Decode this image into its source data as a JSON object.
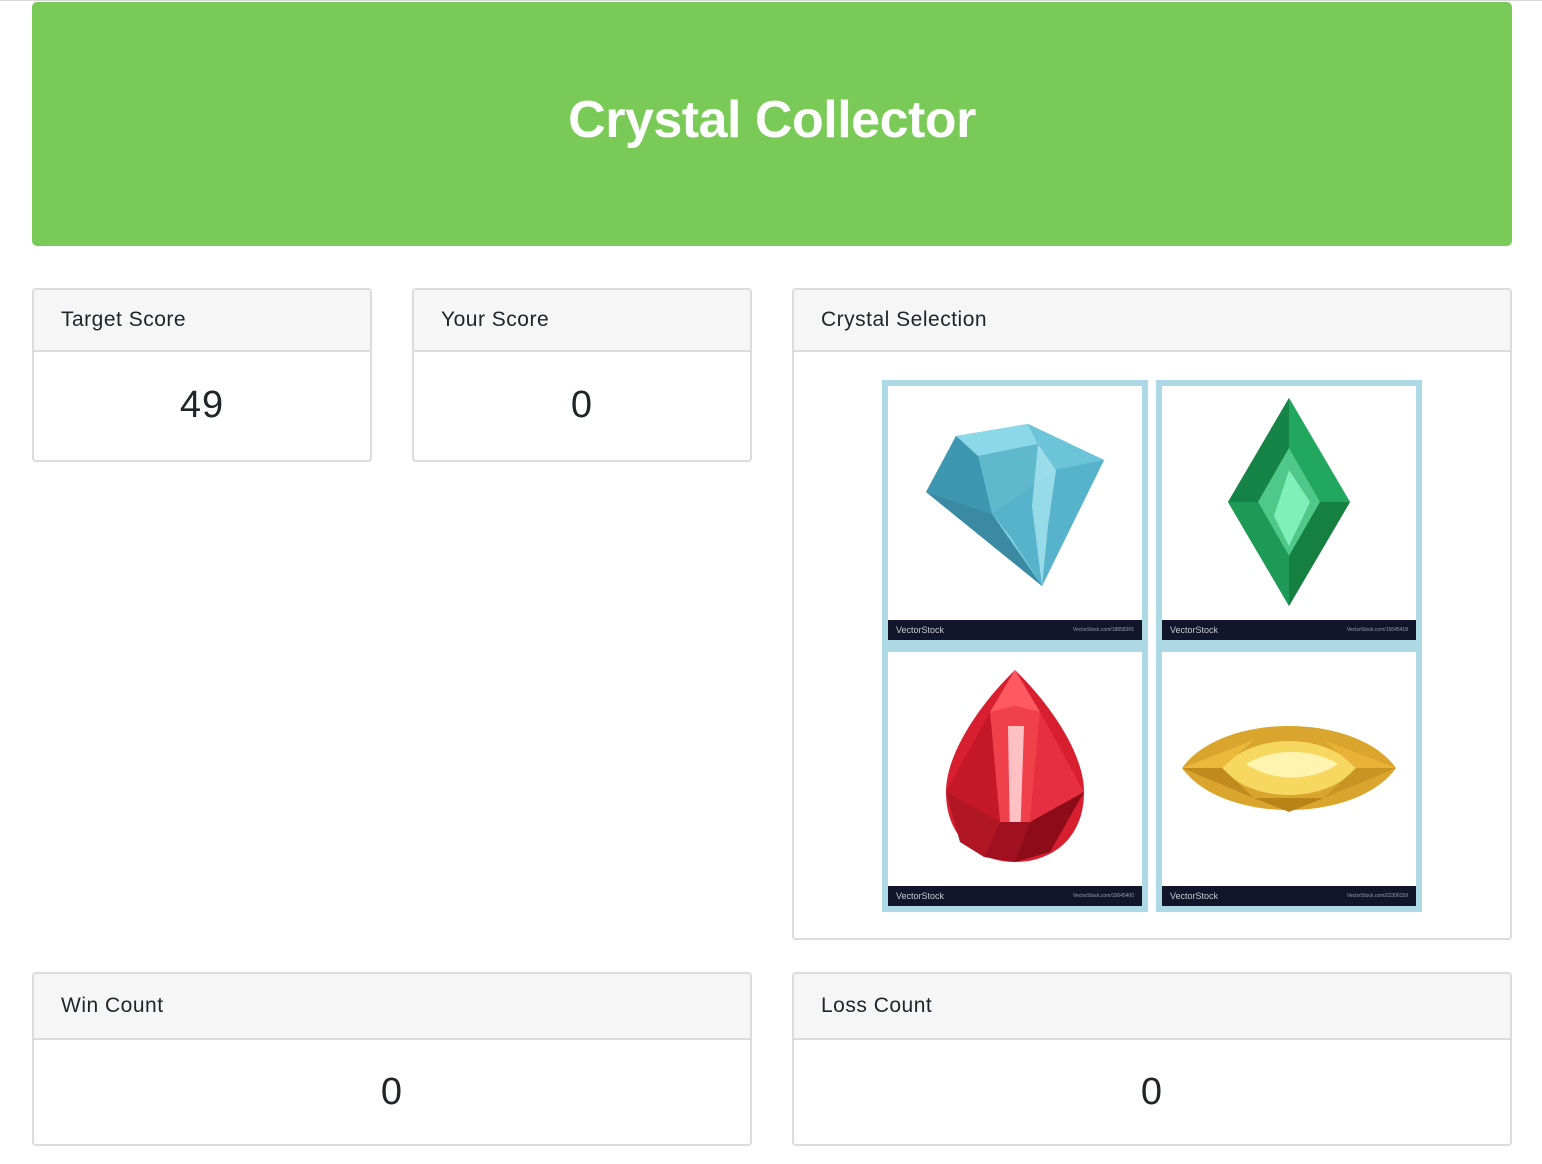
{
  "header": {
    "title": "Crystal Collector"
  },
  "target": {
    "label": "Target Score",
    "value": "49"
  },
  "score": {
    "label": "Your Score",
    "value": "0"
  },
  "crystals": {
    "label": "Crystal Selection",
    "items": [
      {
        "icon": "blue-diamond-crystal-icon",
        "color": "#5cc0d6",
        "watermark": "VectorStock",
        "watermark_url": "VectorStock.com/18858365"
      },
      {
        "icon": "green-emerald-crystal-icon",
        "color": "#1fa05a",
        "watermark": "VectorStock",
        "watermark_url": "VectorStock.com/15645418"
      },
      {
        "icon": "red-ruby-crystal-icon",
        "color": "#e02b3a",
        "watermark": "VectorStock",
        "watermark_url": "VectorStock.com/15645400"
      },
      {
        "icon": "yellow-topaz-crystal-icon",
        "color": "#f2c23b",
        "watermark": "VectorStock",
        "watermark_url": "VectorStock.com/22306159"
      }
    ]
  },
  "wins": {
    "label": "Win Count",
    "value": "0"
  },
  "losses": {
    "label": "Loss Count",
    "value": "0"
  },
  "colors": {
    "banner": "#7aca57",
    "crystal_border": "#add8e6",
    "card_header": "#f6f6f6"
  }
}
